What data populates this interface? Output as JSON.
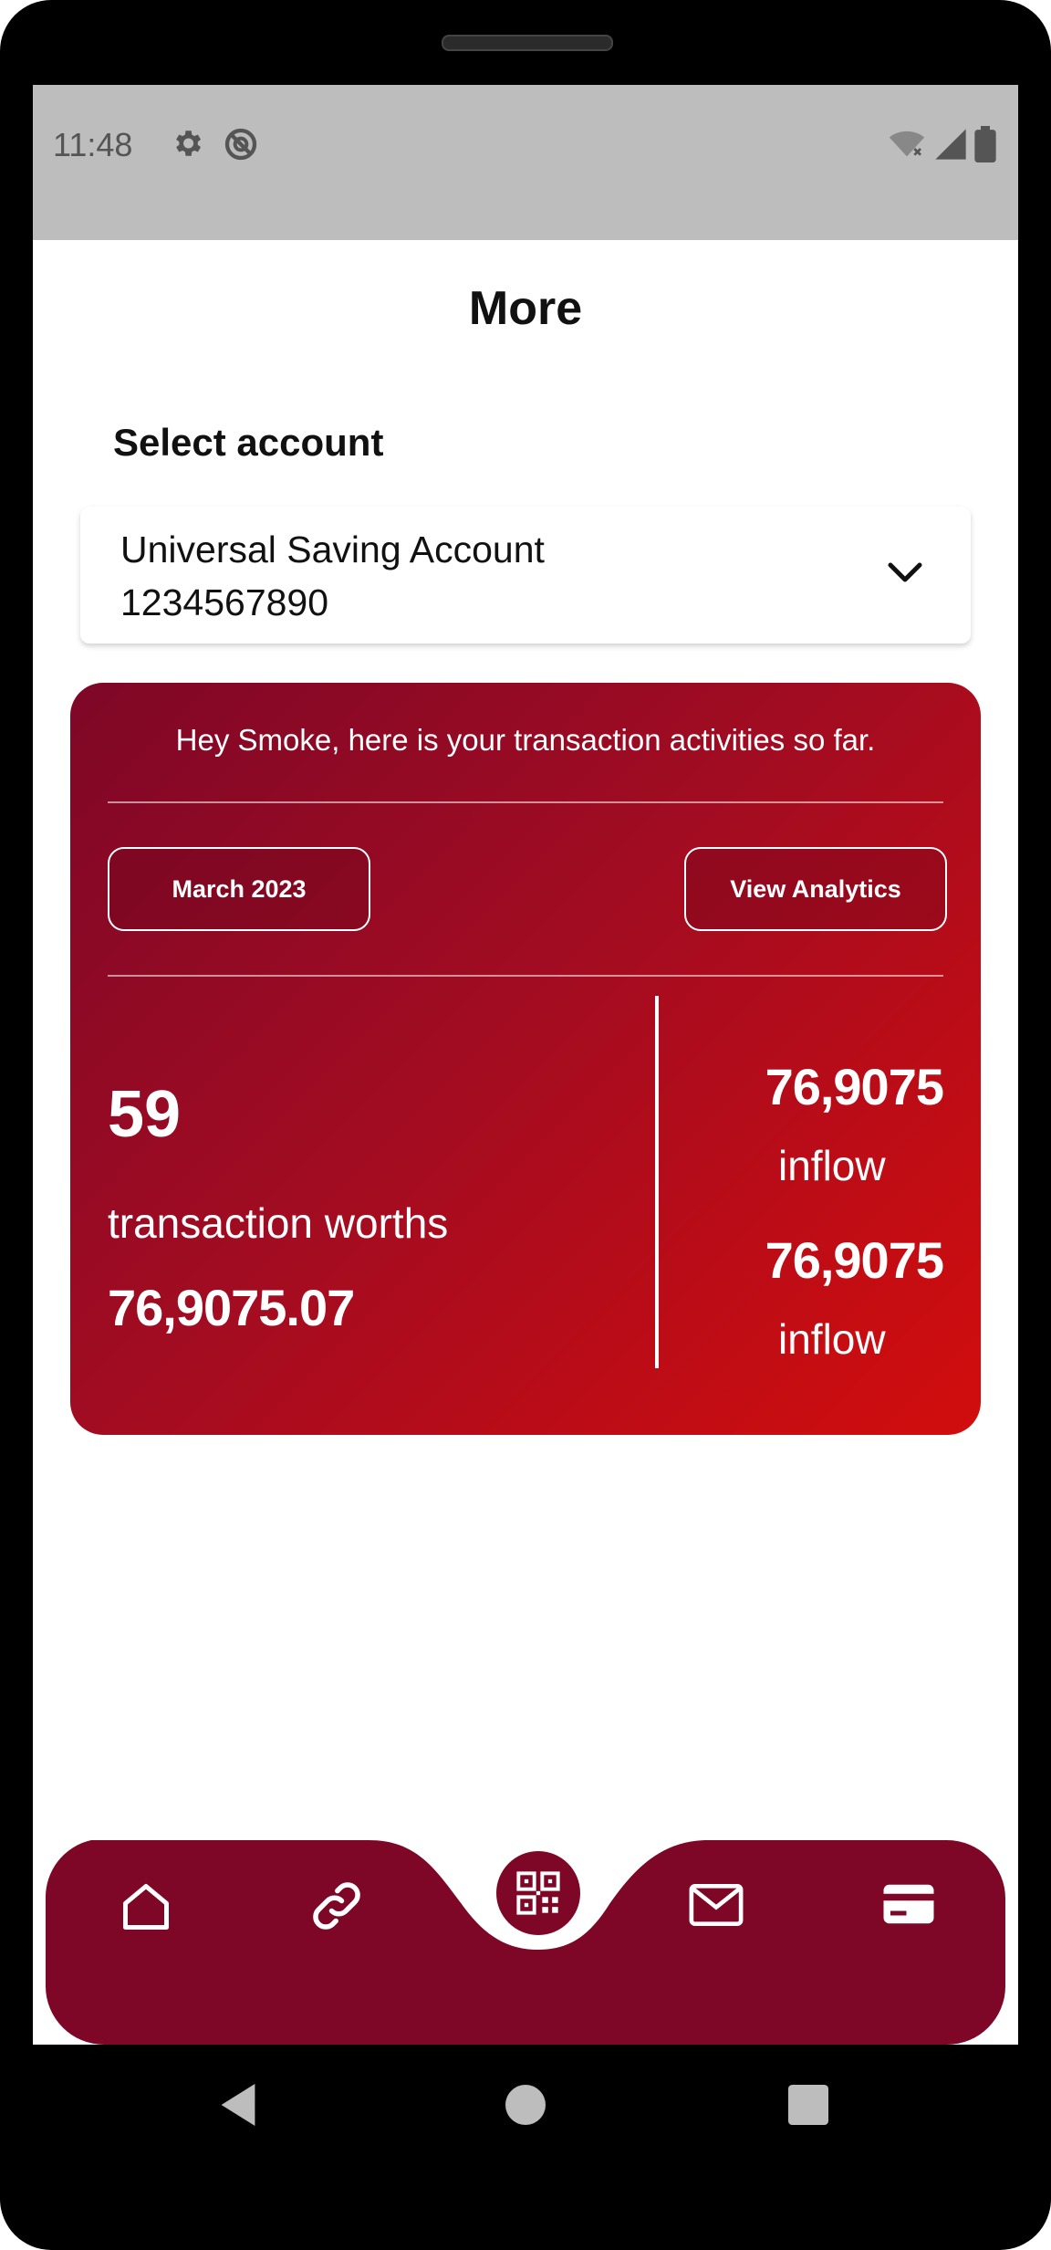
{
  "status_bar": {
    "time": "11:48",
    "left_icons": [
      "gear-icon",
      "do-not-disturb-icon"
    ],
    "right_icons": [
      "wifi-off-icon",
      "signal-icon",
      "battery-icon"
    ]
  },
  "page": {
    "title": "More"
  },
  "account": {
    "label": "Select account",
    "selected_name": "Universal Saving Account",
    "selected_number": "1234567890"
  },
  "summary_card": {
    "greeting": "Hey Smoke, here is your transaction activities so far.",
    "month_button": "March 2023",
    "analytics_button": "View Analytics",
    "transaction_count": "59",
    "transaction_label": "transaction worths",
    "transaction_total": "76,9075.07",
    "flows": [
      {
        "amount": "76,9075",
        "label": "inflow"
      },
      {
        "amount": "76,9075",
        "label": "inflow"
      }
    ],
    "gradient_colors": [
      "#7e0727",
      "#d20d0d"
    ]
  },
  "bottom_nav": {
    "background": "#7e0727",
    "items": [
      "home-icon",
      "link-icon",
      "qr-code-icon",
      "mail-icon",
      "card-icon"
    ]
  },
  "system_nav": [
    "back-icon",
    "home-circle-icon",
    "recents-icon"
  ]
}
